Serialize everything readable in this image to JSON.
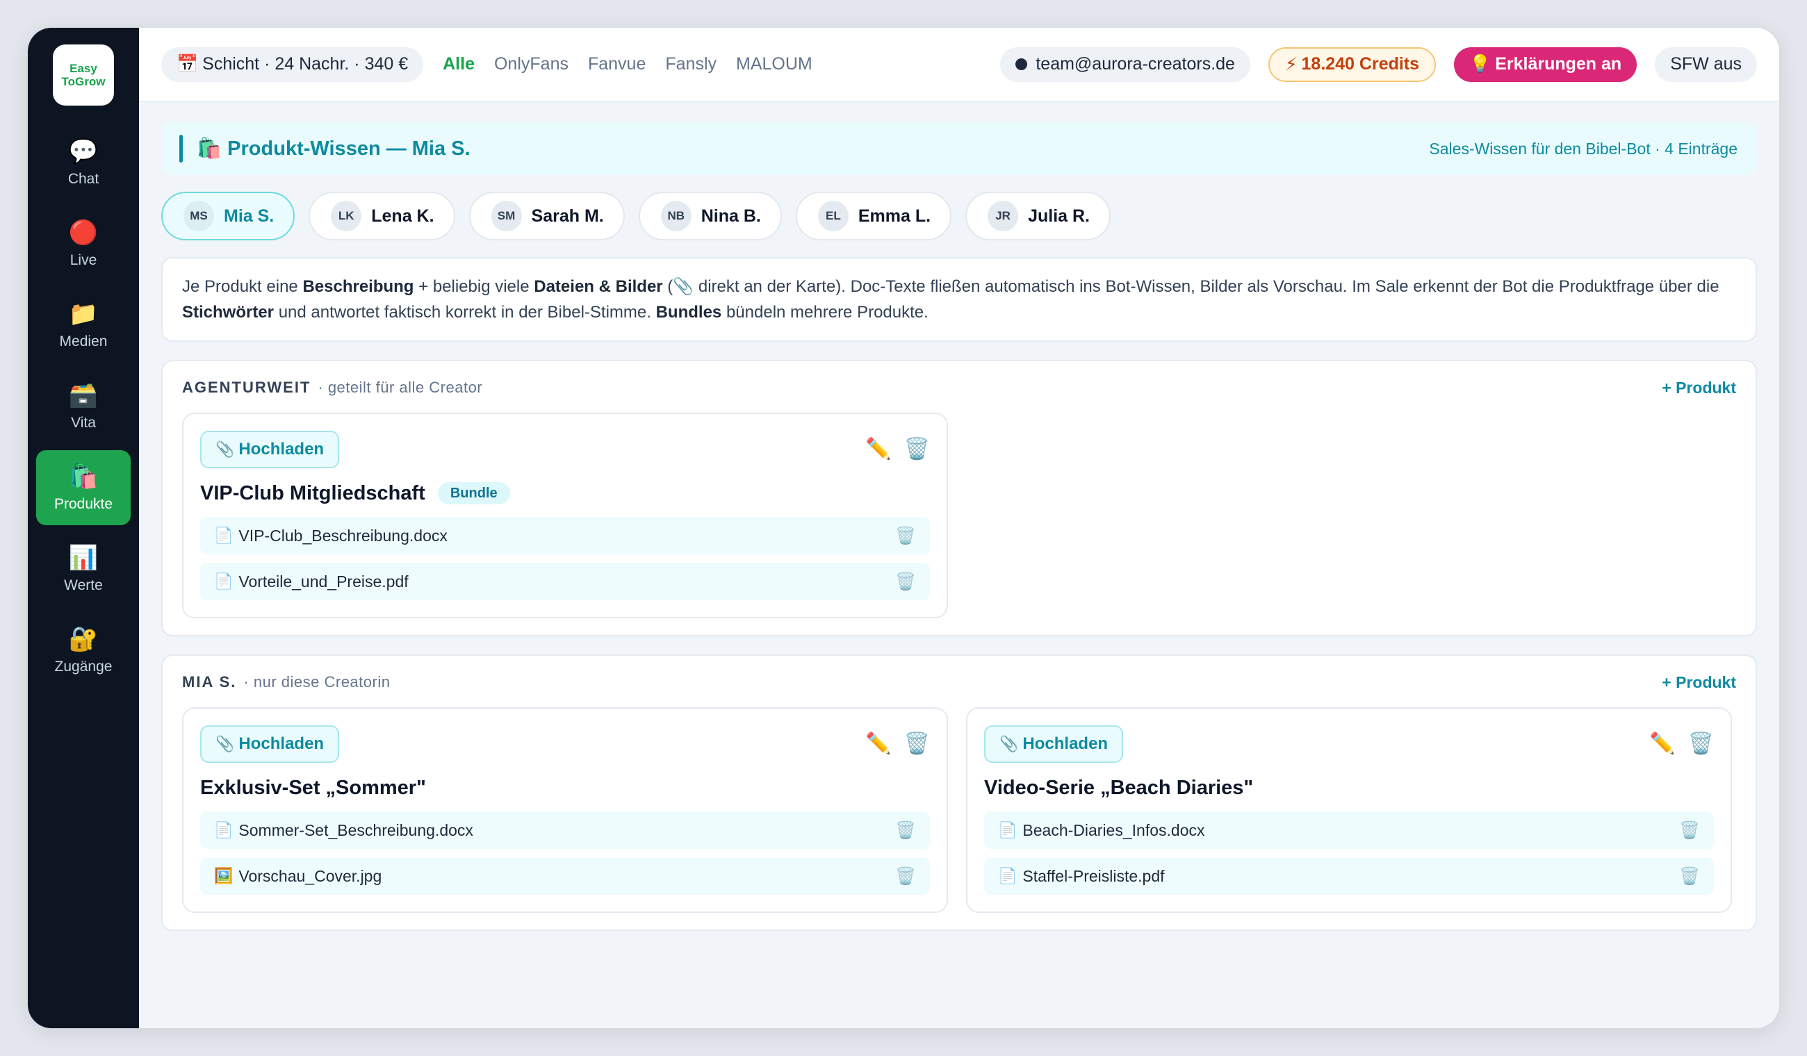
{
  "logo": {
    "line1": "Easy",
    "line2": "ToGrow"
  },
  "sidebar": {
    "items": [
      {
        "label": "Chat",
        "icon": "💬"
      },
      {
        "label": "Live",
        "icon": "🔴"
      },
      {
        "label": "Medien",
        "icon": "📁"
      },
      {
        "label": "Vita",
        "icon": "🗃️"
      },
      {
        "label": "Produkte",
        "icon": "🛍️",
        "active": true
      },
      {
        "label": "Werte",
        "icon": "📊"
      },
      {
        "label": "Zugänge",
        "icon": "🔐"
      }
    ]
  },
  "topbar": {
    "shift_icon": "📅",
    "shift_text": "Schicht · 24 Nachr. · 340 €",
    "platforms": [
      "Alle",
      "OnlyFans",
      "Fanvue",
      "Fansly",
      "MALOUM"
    ],
    "email": "team@aurora-creators.de",
    "credits_icon": "⚡",
    "credits": "18.240 Credits",
    "explain_icon": "💡",
    "explain": "Erklärungen an",
    "sfw": "SFW aus"
  },
  "banner": {
    "icon": "🛍️",
    "title": "Produkt-Wissen — Mia S.",
    "meta": "Sales-Wissen für den Bibel-Bot · 4 Einträge"
  },
  "creators": [
    {
      "initials": "MS",
      "name": "Mia S."
    },
    {
      "initials": "LK",
      "name": "Lena K."
    },
    {
      "initials": "SM",
      "name": "Sarah M."
    },
    {
      "initials": "NB",
      "name": "Nina B."
    },
    {
      "initials": "EL",
      "name": "Emma L."
    },
    {
      "initials": "JR",
      "name": "Julia R."
    }
  ],
  "info": {
    "p1": "Je Produkt eine ",
    "b1": "Beschreibung",
    "p2": " + beliebig viele ",
    "b2": "Dateien & Bilder",
    "p3": " (📎 direkt an der Karte). Doc-Texte fließen automatisch ins Bot-Wissen, Bilder als Vorschau. Im Sale erkennt der Bot die Produktfrage über die ",
    "b3": "Stichwörter",
    "p4": " und antwortet faktisch korrekt in der Bibel-Stimme. ",
    "b4": "Bundles",
    "p5": " bündeln mehrere Produkte."
  },
  "common": {
    "upload_icon": "📎",
    "upload": "Hochladen",
    "edit_icon": "✏️",
    "delete_icon": "🗑️",
    "add_product": "+ Produkt"
  },
  "sections": [
    {
      "title": "AGENTURWEIT",
      "subtitle": "· geteilt für alle Creator",
      "products": [
        {
          "title": "VIP-Club Mitgliedschaft",
          "badge": "Bundle",
          "files": [
            {
              "icon": "📄",
              "name": "VIP-Club_Beschreibung.docx"
            },
            {
              "icon": "📄",
              "name": "Vorteile_und_Preise.pdf"
            }
          ]
        }
      ]
    },
    {
      "title": "MIA S.",
      "subtitle": "· nur diese Creatorin",
      "products": [
        {
          "title": "Exklusiv-Set „Sommer\"",
          "badge": "",
          "files": [
            {
              "icon": "📄",
              "name": "Sommer-Set_Beschreibung.docx"
            },
            {
              "icon": "🖼️",
              "name": "Vorschau_Cover.jpg"
            }
          ]
        },
        {
          "title": "Video-Serie „Beach Diaries\"",
          "badge": "",
          "files": [
            {
              "icon": "📄",
              "name": "Beach-Diaries_Infos.docx"
            },
            {
              "icon": "📄",
              "name": "Staffel-Preisliste.pdf"
            }
          ]
        }
      ]
    }
  ]
}
